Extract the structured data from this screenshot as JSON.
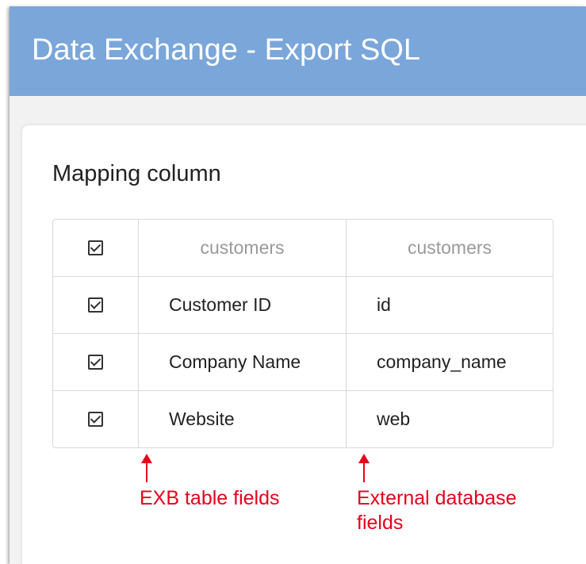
{
  "header": {
    "title": "Data Exchange - Export SQL"
  },
  "section": {
    "title": "Mapping column"
  },
  "table": {
    "header": {
      "checked": true,
      "exb_table": "customers",
      "external_table": "customers"
    },
    "rows": [
      {
        "checked": true,
        "exb_field": "Customer ID",
        "external_field": "id"
      },
      {
        "checked": true,
        "exb_field": "Company Name",
        "external_field": "company_name"
      },
      {
        "checked": true,
        "exb_field": "Website",
        "external_field": "web"
      }
    ]
  },
  "annotations": {
    "exb_label": "EXB table fields",
    "external_label_line1": "External database",
    "external_label_line2": "fields",
    "color": "#e8001c"
  },
  "colors": {
    "header_bg": "#7aa6da",
    "page_bg": "#f2f2f2",
    "card_bg": "#ffffff"
  }
}
